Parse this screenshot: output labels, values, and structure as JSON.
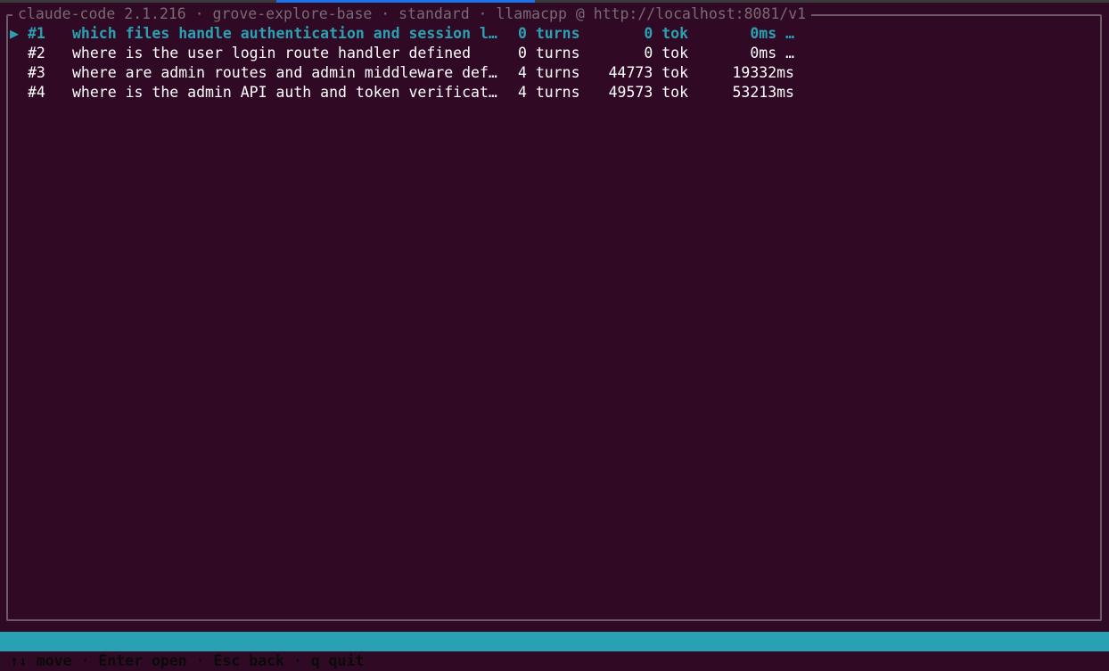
{
  "frame": {
    "title": "claude-code 2.1.216 · grove-explore-base · standard · llamacpp @ http://localhost:8081/v1"
  },
  "colors": {
    "background": "#300a24",
    "accent": "#2aa1b3",
    "frame_border": "#6b5a66",
    "dim_text": "#7a6a75"
  },
  "cursor_icon": "▶",
  "rows": [
    {
      "num": "#1",
      "query": "which files handle authentication and session l…",
      "turns": "0 turns",
      "tok": "0 tok",
      "ms": "0ms …",
      "selected": true
    },
    {
      "num": "#2",
      "query": "where is the user login route handler defined",
      "turns": "0 turns",
      "tok": "0 tok",
      "ms": "0ms …",
      "selected": false
    },
    {
      "num": "#3",
      "query": "where are admin routes and admin middleware def…",
      "turns": "4 turns",
      "tok": "44773 tok",
      "ms": "19332ms",
      "selected": false
    },
    {
      "num": "#4",
      "query": "where is the admin API auth and token verificat…",
      "turns": "4 turns",
      "tok": "49573 tok",
      "ms": "53213ms",
      "selected": false
    }
  ],
  "statusbar": {
    "hints": "↑↓ move · Enter open · Esc back · q quit"
  }
}
